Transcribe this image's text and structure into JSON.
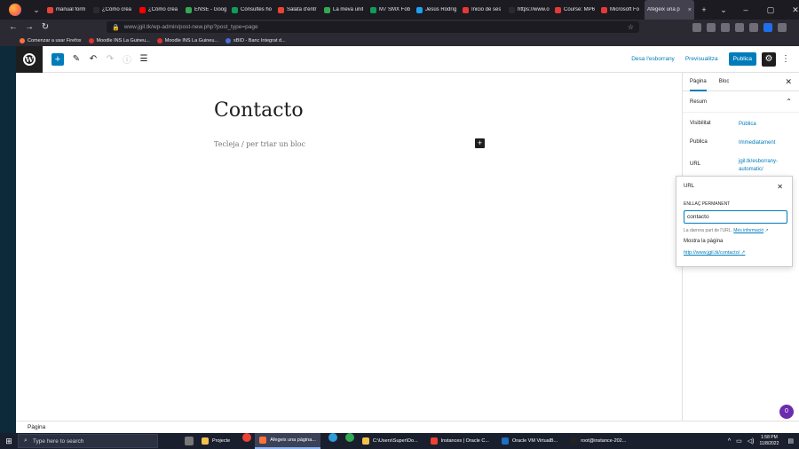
{
  "browser": {
    "tabs": [
      {
        "label": "manual form",
        "color": "#ea4335"
      },
      {
        "label": "¿Cómo crea",
        "color": "#2b2a33"
      },
      {
        "label": "¿Cómo crea",
        "color": "#ff0000"
      },
      {
        "label": "ENSE - Goog",
        "color": "#34a853"
      },
      {
        "label": "Consultes ho",
        "color": "#0f9d58"
      },
      {
        "label": "Salata d'entr",
        "color": "#ea4335"
      },
      {
        "label": "La meva unit",
        "color": "#34a853"
      },
      {
        "label": "M7 SMX Fob",
        "color": "#0f9d58"
      },
      {
        "label": "Jesús Rodríg",
        "color": "#1da1f2"
      },
      {
        "label": "Inicio de ses",
        "color": "#e53935"
      },
      {
        "label": "https://www.ora",
        "color": "#2b2a33"
      },
      {
        "label": "Course: MP6",
        "color": "#e53935"
      },
      {
        "label": "Microsoft Fo",
        "color": "#e53935"
      }
    ],
    "active_tab": {
      "label": "Afegeix una p",
      "close": "×"
    },
    "new_tab": "+",
    "tab_list": "⌄",
    "window_controls": {
      "minimize": "–",
      "maximize": "▢",
      "close": "✕"
    },
    "nav": {
      "back": "←",
      "forward": "→",
      "reload": "↻"
    },
    "url": "www.jgil.tk/wp-admin/post-new.php?post_type=page",
    "bookmarks": [
      "Comenzar a usar Firefox",
      "Moodle INS La Guineu...",
      "Moodle INS La Guineu...",
      "sBID - Banc Integrat d..."
    ]
  },
  "editor": {
    "top": {
      "save_draft": "Desa l'esborrany",
      "preview": "Previsualitza",
      "publish": "Publica"
    },
    "title": "Contacto",
    "block_placeholder": "Tecleja / per triar un bloc",
    "status_bar": "Pàgina",
    "help_bubble": "0"
  },
  "sidebar": {
    "tabs": [
      "Pàgina",
      "Bloc"
    ],
    "panel_title": "Resum",
    "rows": [
      {
        "key": "Visibilitat",
        "value": "Pública"
      },
      {
        "key": "Publica",
        "value": "Immediatament"
      },
      {
        "key": "URL",
        "value": "jgil.tk/esborrany-automatic/"
      }
    ]
  },
  "url_popover": {
    "title": "URL",
    "label": "Enllaç permanent",
    "value": "contacto",
    "help": "La darrera part de l'URL.",
    "help_link": "Més informació",
    "view_label": "Mostra la pàgina",
    "view_link": "http://www.jgil.tk/contacto/"
  },
  "taskbar": {
    "search_placeholder": "Type here to search",
    "tasks": [
      {
        "label": "Projecte",
        "color": "#f2c14e"
      },
      {
        "label": "Afegeix una pàgina...",
        "color": "#ff7139",
        "active": true
      },
      {
        "label": "C:\\Users\\Super\\Do...",
        "color": "#f2c14e"
      },
      {
        "label": "Instances | Oracle C...",
        "color": "#ea4335"
      },
      {
        "label": "Oracle VM VirtualB...",
        "color": "#1e6fbf"
      },
      {
        "label": "root@instance-202...",
        "color": "#222222"
      }
    ],
    "time": "1:58 PM",
    "date": "11/8/2022"
  }
}
